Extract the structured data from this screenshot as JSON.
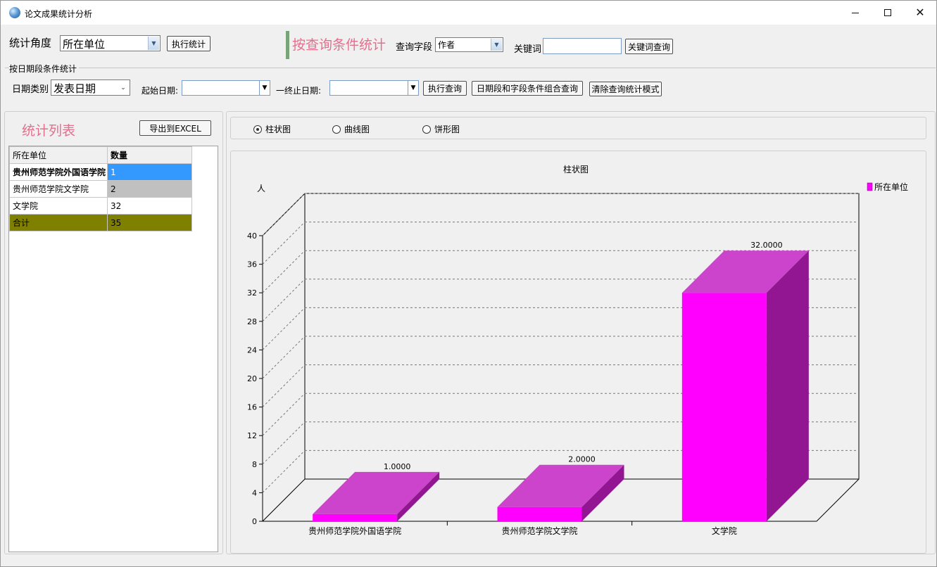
{
  "window": {
    "title": "论文成果统计分析"
  },
  "stats_angle": {
    "label": "统计角度",
    "selected": "所在单位",
    "execute_label": "执行统计"
  },
  "query": {
    "title": "按查询条件统计",
    "field_label": "查询字段",
    "field_selected": "作者",
    "keyword_label": "关键词",
    "keyword_value": "",
    "keyword_button": "关键词查询"
  },
  "date_group": {
    "legend": "按日期段条件统计",
    "type_label": "日期类别",
    "type_selected": "发表日期",
    "start_label": "起始日期:",
    "start_value": "",
    "end_label": "一终止日期:",
    "end_value": "",
    "execute_query": "执行查询",
    "combined_query": "日期段和字段条件组合查询",
    "clear_mode": "清除查询统计模式"
  },
  "list": {
    "title": "统计列表",
    "export_label": "导出到EXCEL",
    "headers": [
      "所在单位",
      "数量"
    ],
    "rows": [
      {
        "unit": "贵州师范学院外国语学院",
        "count": "1"
      },
      {
        "unit": "贵州师范学院文学院",
        "count": "2"
      },
      {
        "unit": "文学院",
        "count": "32"
      },
      {
        "unit": "合计",
        "count": "35"
      }
    ]
  },
  "chart_options": {
    "bar": "柱状图",
    "line": "曲线图",
    "pie": "饼形图",
    "selected": "bar"
  },
  "colors": {
    "accent_pink": "#e46f8c",
    "bar_front": "#ff00ff",
    "bar_top": "#cc44cc",
    "bar_side": "#921692",
    "row_selected": "#3399ff",
    "row_gray": "#c0c0c0",
    "row_total": "#808000"
  },
  "chart_data": {
    "type": "bar",
    "title": "柱状图",
    "ylabel": "人",
    "xlabel": "",
    "categories": [
      "贵州师范学院外国语学院",
      "贵州师范学院文学院",
      "文学院"
    ],
    "series": [
      {
        "name": "所在单位",
        "values": [
          1,
          2,
          32
        ]
      }
    ],
    "data_labels": [
      "1.0000",
      "2.0000",
      "32.0000"
    ],
    "ylim": [
      0,
      40
    ],
    "yticks": [
      0,
      4,
      8,
      12,
      16,
      20,
      24,
      28,
      32,
      36,
      40
    ],
    "grid": true,
    "legend": "top-right",
    "three_d": true
  }
}
